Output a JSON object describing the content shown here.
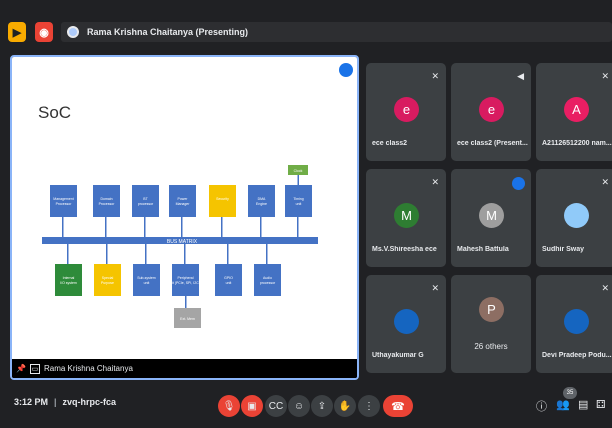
{
  "top_bar": {
    "presenter_label": "Rama Krishna Chaitanya (Presenting)",
    "colors": {
      "yellow": "#f9ab00",
      "red": "#ea4335"
    }
  },
  "stage": {
    "slide": {
      "title": "SoC",
      "bus_label": "BUS MATRIX",
      "top_blocks": [
        {
          "label": "Management Processor",
          "color": "#4472c4"
        },
        {
          "label": "Domain Processor",
          "color": "#4472c4"
        },
        {
          "label": "BT processor",
          "color": "#4472c4"
        },
        {
          "label": "Power Manager",
          "color": "#4472c4"
        },
        {
          "label": "Security",
          "color": "#f5c400"
        },
        {
          "label": "DMA Engine",
          "color": "#4472c4"
        },
        {
          "label": "Timing unit",
          "color": "#4472c4"
        }
      ],
      "bottom_blocks": [
        {
          "label": "Internal I/O system",
          "color": "#2e8b3a"
        },
        {
          "label": "Special Purpose",
          "color": "#f5c400"
        },
        {
          "label": "Sub-system unit",
          "color": "#4472c4"
        },
        {
          "label": "Peripheral unit (PCIe, SPI, I2C...)",
          "color": "#4472c4"
        },
        {
          "label": "GPIO unit",
          "color": "#4472c4"
        },
        {
          "label": "Audio processor",
          "color": "#4472c4"
        }
      ],
      "extra_top": {
        "label": "Clock",
        "color": "#70ad47"
      },
      "extra_bottom": {
        "label": "Ext. Mem",
        "color": "#a5a5a5"
      }
    },
    "caption": "Rama Krishna Chaitanya"
  },
  "participants": [
    {
      "name": "ece class2",
      "initial": "e",
      "avatar_color": "#d81b60",
      "status": "mic-off"
    },
    {
      "name": "ece class2 (Present...",
      "initial": "e",
      "avatar_color": "#d81b60",
      "status": "sound"
    },
    {
      "name": "A21126512200 nam...",
      "initial": "A",
      "avatar_color": "#e91e63",
      "status": "mic-off"
    },
    {
      "name": "Ms.V.Shireesha ece",
      "initial": "M",
      "avatar_color": "#2e7d32",
      "status": "mic-off"
    },
    {
      "name": "Mahesh Battula",
      "initial": "M",
      "avatar_color": "#9e9e9e",
      "status": "speaking"
    },
    {
      "name": "Sudhir Sway",
      "initial": "",
      "avatar_color": "#90caf9",
      "status": "mic-off"
    },
    {
      "name": "Uthayakumar G",
      "initial": "",
      "avatar_color": "#1565c0",
      "status": "mic-off"
    },
    {
      "name": "26 others",
      "initial": "P",
      "avatar_color": "#8d6e63",
      "status": "none"
    },
    {
      "name": "Devi Pradeep Podu...",
      "initial": "",
      "avatar_color": "#1565c0",
      "status": "mic-off"
    }
  ],
  "bottom_bar": {
    "time": "3:12 PM",
    "meeting_code": "zvq-hrpc-fca",
    "participant_count": "35",
    "controls": [
      {
        "name": "mic-off-button",
        "icon": "mic-off-icon",
        "glyph": "🎙",
        "red": true
      },
      {
        "name": "camera-off-button",
        "icon": "camera-off-icon",
        "glyph": "▣",
        "red": true
      },
      {
        "name": "captions-button",
        "icon": "captions-icon",
        "glyph": "CC",
        "red": false
      },
      {
        "name": "emoji-button",
        "icon": "emoji-icon",
        "glyph": "☺",
        "red": false
      },
      {
        "name": "present-button",
        "icon": "present-icon",
        "glyph": "⇪",
        "red": false
      },
      {
        "name": "raise-hand-button",
        "icon": "hand-icon",
        "glyph": "✋",
        "red": false
      },
      {
        "name": "more-options-button",
        "icon": "more-vert-icon",
        "glyph": "⋮",
        "red": false
      }
    ],
    "leave_glyph": "☎"
  }
}
